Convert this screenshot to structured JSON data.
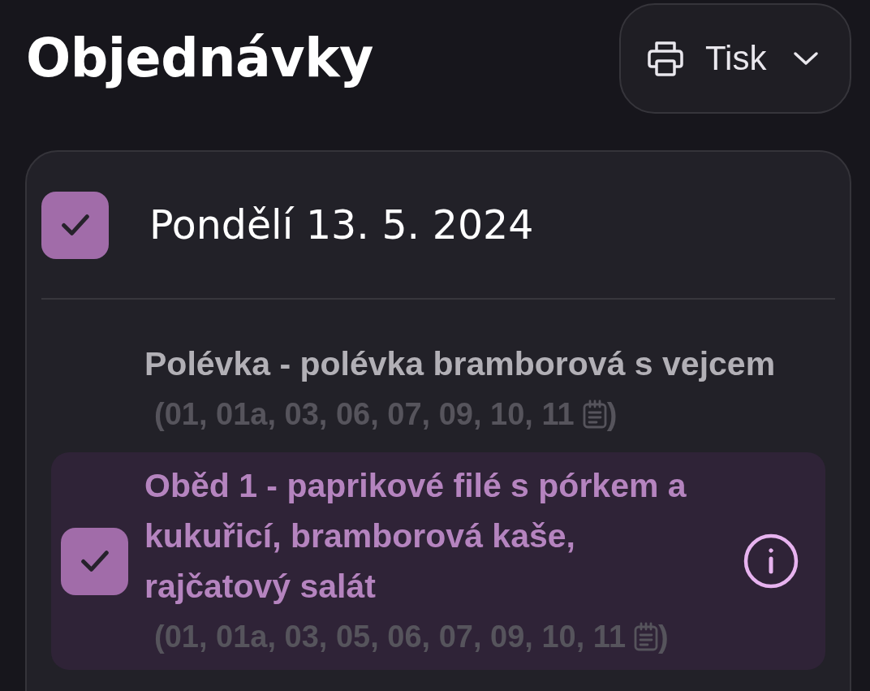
{
  "header": {
    "title": "Objednávky",
    "print_button": {
      "label": "Tisk"
    }
  },
  "days": [
    {
      "date": "Pondělí 13. 5. 2024",
      "checked": true,
      "items": [
        {
          "name": "Polévka - polévka bramborová s vejcem",
          "allergens": "(01, 01a, 03, 06, 07, 09, 10, 11",
          "allergens_end": ")",
          "selected": false
        },
        {
          "name": "Oběd 1 - paprikové filé s pórkem a kukuřicí, bramborová kaše, rajčatový salát",
          "allergens": "(01, 01a, 03, 05, 06, 07, 09, 10, 11",
          "allergens_end": ")",
          "selected": true
        }
      ]
    }
  ]
}
